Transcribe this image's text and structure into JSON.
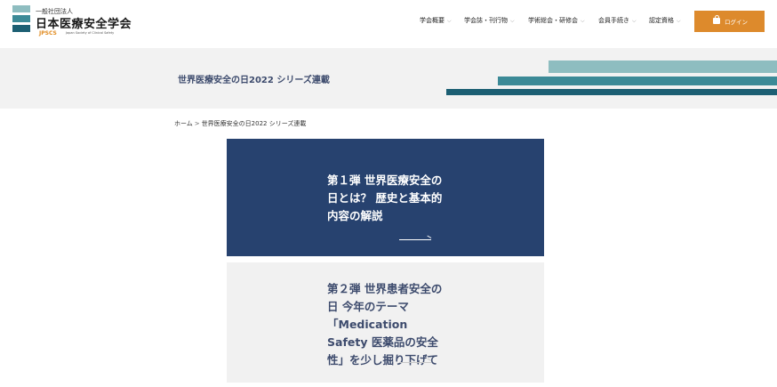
{
  "header": {
    "logo": {
      "subtitle": "一般社団法人",
      "name": "日本医療安全学会",
      "abbr": "JPSCS",
      "english": "Japan Society of Clinical Safety",
      "colors": [
        "#8ebdc0",
        "#3c8a97",
        "#1c5f73"
      ]
    },
    "nav": [
      {
        "label": "学会概要",
        "icon": "chevron-down-icon"
      },
      {
        "label": "学会誌・刊行物",
        "icon": "chevron-down-icon"
      },
      {
        "label": "学術総会・研修会",
        "icon": "chevron-down-icon"
      },
      {
        "label": "会員手続き",
        "icon": "chevron-down-icon"
      },
      {
        "label": "認定資格",
        "icon": "chevron-down-icon"
      }
    ],
    "login": {
      "label": "ログイン",
      "icon": "lock-icon",
      "color": "#dd8a2c"
    }
  },
  "banner": {
    "title": "世界医療安全の日2022 シリーズ連載"
  },
  "breadcrumb": {
    "home": "ホーム",
    "separator": ">",
    "current": "世界医療安全の日2022 シリーズ連載"
  },
  "cards": [
    {
      "title": "第１弾 世界医療安全の日とは？ 歴史と基本的内容の解説",
      "background": "#27426f",
      "arrow_icon": "arrow-right-icon"
    },
    {
      "title": "第２弾 世界患者安全の日 今年のテーマ「Medication Safety 医薬品の安全性」を少し掘り下げて",
      "background": "#f1f1f1",
      "arrow_icon": "arrow-right-icon"
    }
  ]
}
